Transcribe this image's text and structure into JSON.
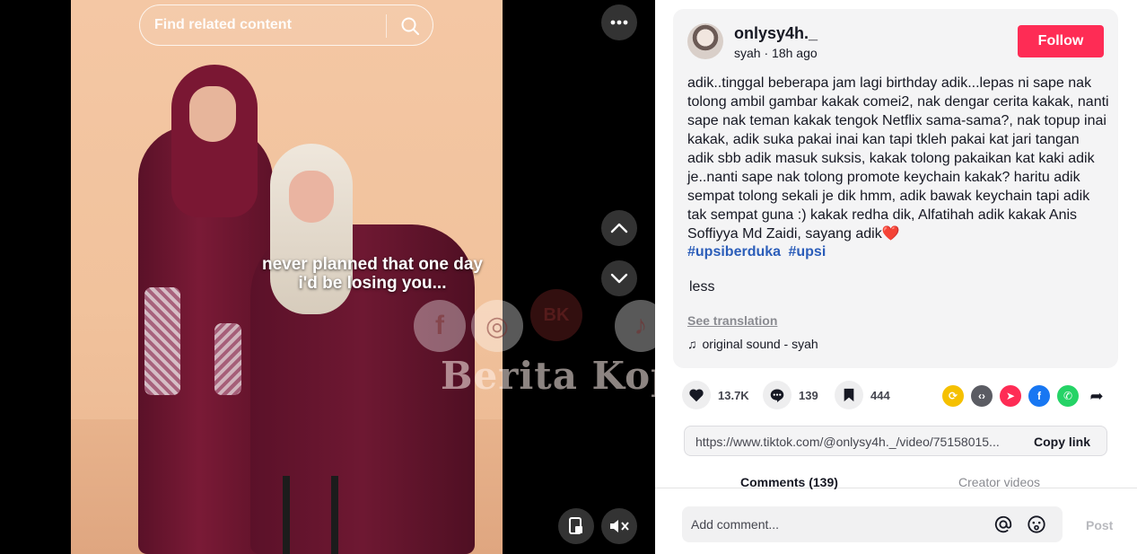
{
  "video": {
    "search_placeholder": "Find related content",
    "caption_line1": "never planned that one day",
    "caption_line2": "i'd be losing you...",
    "watermark_text": "Berita Kopak",
    "watermark_badge": "BK"
  },
  "author": {
    "username": "onlysy4h._",
    "display_name": "syah",
    "separator": " · ",
    "posted": "18h ago",
    "follow_label": "Follow"
  },
  "post": {
    "description": "adik..tinggal beberapa jam lagi birthday adik...lepas ni sape nak tolong ambil gambar kakak comei2, nak dengar cerita kakak, nanti sape nak teman kakak tengok Netflix sama-sama?, nak topup inai kakak, adik suka pakai inai kan tapi tkleh pakai kat jari tangan adik sbb adik masuk suksis, kakak tolong pakaikan kat kaki adik je..nanti sape nak tolong promote keychain kakak? haritu adik sempat tolong sekali je dik hmm, adik bawak keychain tapi adik tak sempat guna :) kakak redha dik, Alfatihah adik kakak Anis Soffiyya Md Zaidi, sayang adik",
    "emoji": "❤️",
    "hashtags": [
      "#upsiberduka",
      "#upsi"
    ],
    "less_label": "less",
    "see_translation": "See translation",
    "sound": "original sound - syah"
  },
  "stats": {
    "likes": "13.7K",
    "comments": "139",
    "saves": "444"
  },
  "share": {
    "url": "https://www.tiktok.com/@onlysy4h._/video/75158015...",
    "copy_label": "Copy link"
  },
  "tabs": {
    "comments": "Comments (139)",
    "creator_videos": "Creator videos"
  },
  "comment_input": {
    "placeholder": "Add comment...",
    "post_label": "Post"
  },
  "colors": {
    "follow": "#fe2c55",
    "hashtag": "#2b5db9",
    "repost": "#f5c000",
    "embed": "#5b5c63",
    "send": "#fe2c55",
    "facebook": "#1877f2",
    "whatsapp": "#25d366"
  }
}
